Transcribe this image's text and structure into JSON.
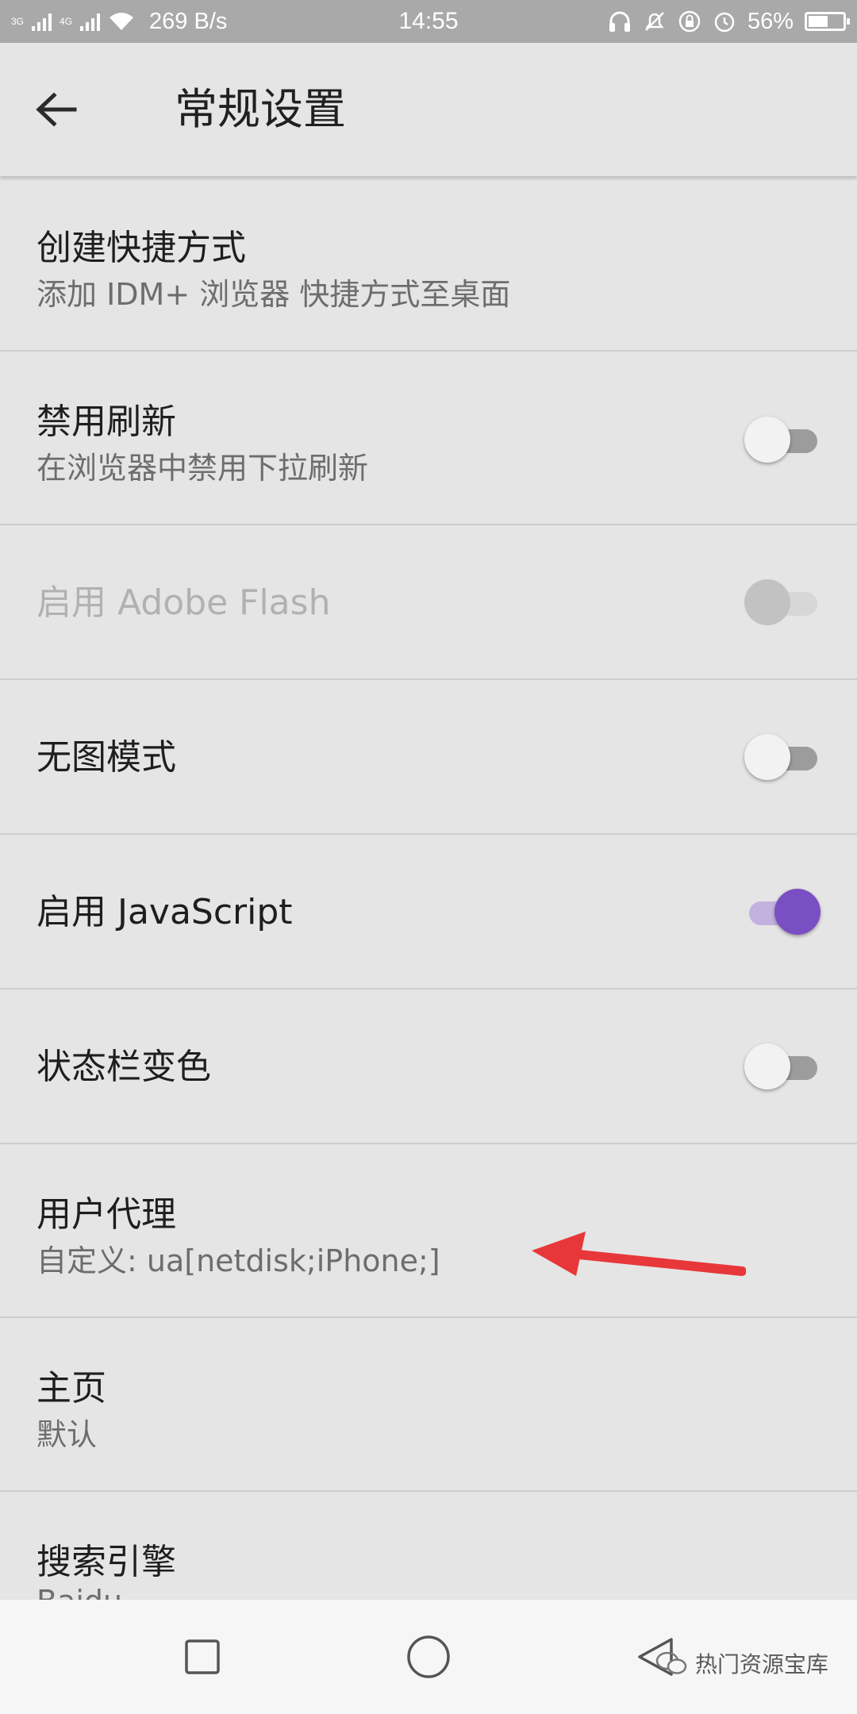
{
  "status_bar": {
    "net_1": "3G",
    "net_2": "4G",
    "speed": "269 B/s",
    "time": "14:55",
    "battery_text": "56%",
    "battery_level": 0.56
  },
  "toolbar": {
    "title": "常规设置"
  },
  "settings": [
    {
      "label": "创建快捷方式",
      "sub": "添加 IDM+ 浏览器 快捷方式至桌面"
    },
    {
      "label": "禁用刷新",
      "sub": "在浏览器中禁用下拉刷新",
      "toggle": "off"
    },
    {
      "label": "启用 Adobe Flash",
      "toggle": "disabled"
    },
    {
      "label": "无图模式",
      "toggle": "off"
    },
    {
      "label": "启用 JavaScript",
      "toggle": "on"
    },
    {
      "label": "状态栏变色",
      "toggle": "off"
    },
    {
      "label": "用户代理",
      "sub": "自定义: ua[netdisk;iPhone;]"
    },
    {
      "label": "主页",
      "sub": "默认"
    },
    {
      "label": "搜索引擎",
      "sub": "Baidu"
    }
  ],
  "watermark": {
    "text": "热门资源宝库"
  },
  "colors": {
    "accent": "#7b4fc4",
    "annotation_arrow": "#e8373a"
  }
}
